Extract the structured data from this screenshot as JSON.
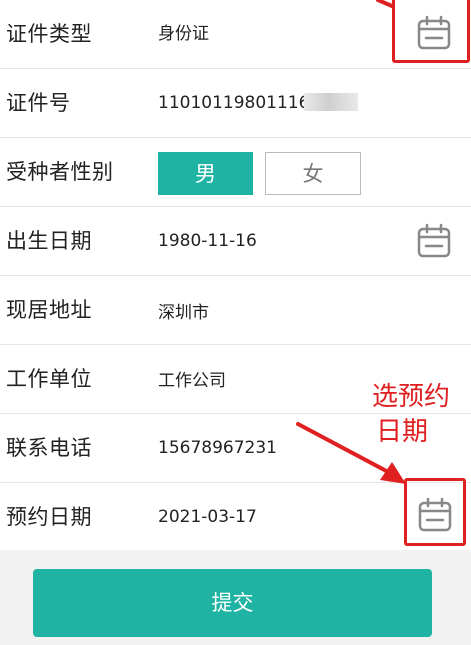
{
  "form": {
    "id_type": {
      "label": "证件类型",
      "value": "身份证",
      "icon": "calendar-icon"
    },
    "id_number": {
      "label": "证件号",
      "value": "11010119801116"
    },
    "gender": {
      "label": "受种者性别",
      "options": [
        "男",
        "女"
      ],
      "selected": "男"
    },
    "birth_date": {
      "label": "出生日期",
      "value": "1980-11-16",
      "icon": "calendar-icon"
    },
    "address": {
      "label": "现居地址",
      "value": "深圳市"
    },
    "work_unit": {
      "label": "工作单位",
      "value": "工作公司"
    },
    "phone": {
      "label": "联系电话",
      "value": "15678967231"
    },
    "appointment_date": {
      "label": "预约日期",
      "value": "2021-03-17",
      "icon": "calendar-icon"
    }
  },
  "submit_label": "提交",
  "annotation": {
    "line1": "选预约",
    "line2": "日期"
  },
  "colors": {
    "accent": "#1fb3a4",
    "annotation": "#e02020",
    "icon_gray": "#888888"
  }
}
